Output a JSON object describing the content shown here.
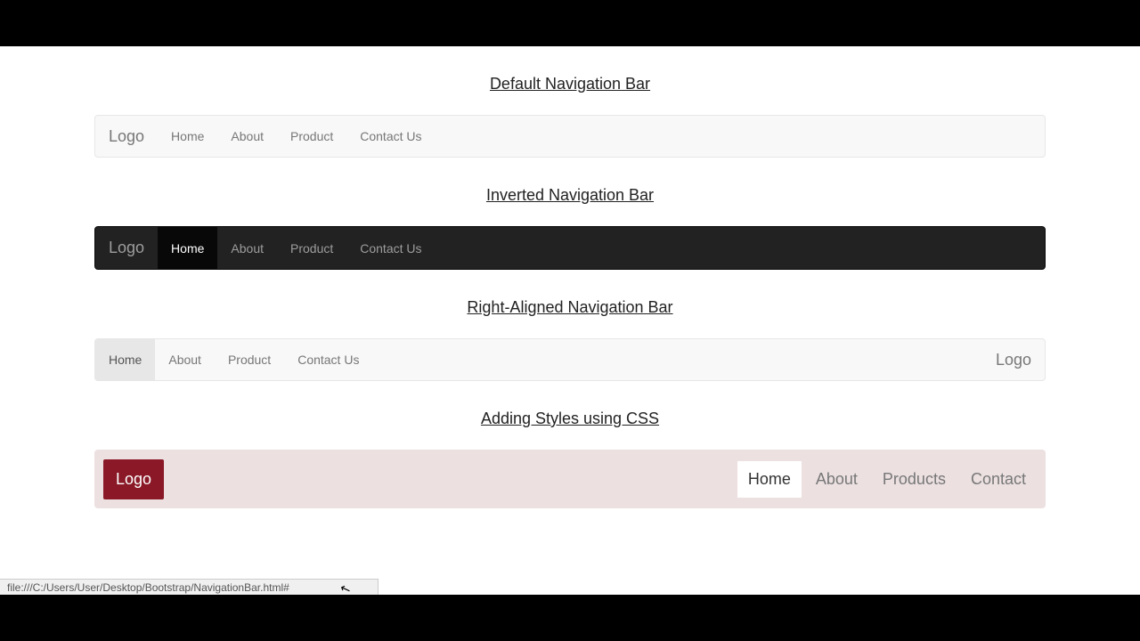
{
  "sections": {
    "default": {
      "title": "Default Navigation Bar",
      "brand": "Logo",
      "items": [
        "Home",
        "About",
        "Product",
        "Contact Us"
      ]
    },
    "inverted": {
      "title": "Inverted Navigation Bar",
      "brand": "Logo",
      "items": [
        "Home",
        "About",
        "Product",
        "Contact Us"
      ]
    },
    "right": {
      "title": "Right-Aligned Navigation Bar",
      "brand": "Logo",
      "items": [
        "Home",
        "About",
        "Product",
        "Contact Us"
      ]
    },
    "styled": {
      "title": "Adding Styles using CSS",
      "brand": "Logo",
      "items": [
        "Home",
        "About",
        "Products",
        "Contact"
      ]
    }
  },
  "status_url": "file:///C:/Users/User/Desktop/Bootstrap/NavigationBar.html#"
}
